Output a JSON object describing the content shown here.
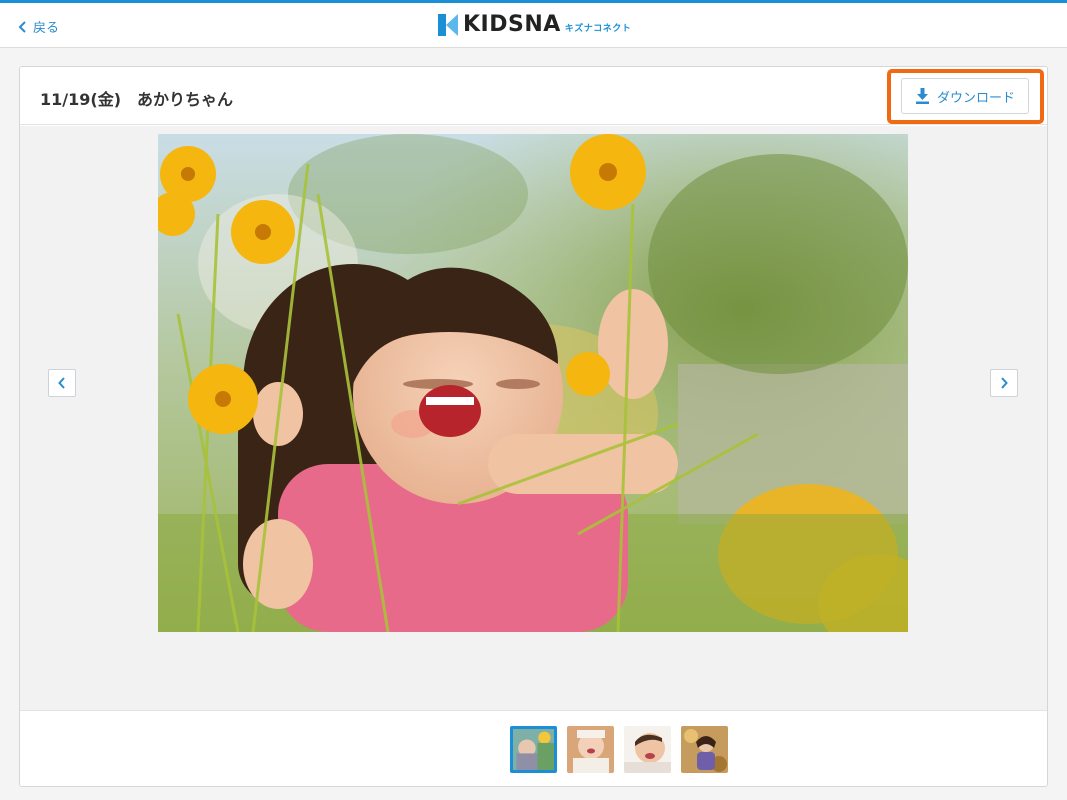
{
  "header": {
    "back_label": "戻る",
    "logo_text": "KIDSNA",
    "logo_sub": "キズナコネクト",
    "brand_color": "#1a8fd6"
  },
  "album": {
    "title": "11/19(金)　あかりちゃん",
    "download_label": "ダウンロード",
    "highlight_color": "#ef6a12"
  },
  "viewer": {
    "photo_icon": "photo-girl-flowers",
    "prev_icon": "chevron-left-icon",
    "next_icon": "chevron-right-icon"
  },
  "thumbnails": [
    {
      "name": "thumbnail-1",
      "active": true
    },
    {
      "name": "thumbnail-2",
      "active": false
    },
    {
      "name": "thumbnail-3",
      "active": false
    },
    {
      "name": "thumbnail-4",
      "active": false
    }
  ]
}
